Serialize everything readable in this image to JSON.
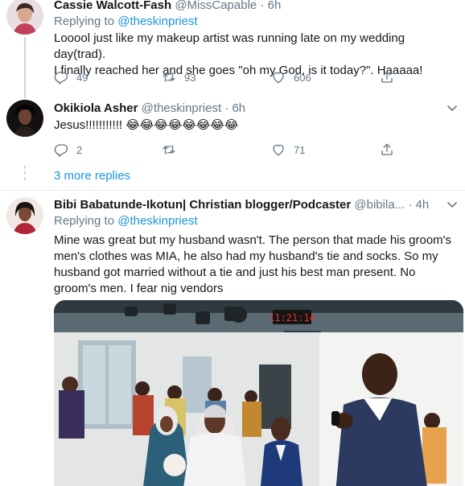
{
  "tweets": [
    {
      "name": "Cassie Walcott-Fash",
      "handle": "@MissCapable",
      "sep": "·",
      "time": "6h",
      "replying_prefix": "Replying to",
      "replying_to": "@theskinpriest",
      "text_lines": [
        "Looool just like my makeup artist was running late on my wedding day(trad).",
        "I finally reached her and she goes \"oh my God, is it today?\". Haaaaa!"
      ],
      "reply_count": "49",
      "retweet_count": "93",
      "like_count": "606"
    },
    {
      "name": "Okikiola Asher",
      "handle": "@theskinpriest",
      "sep": "·",
      "time": "6h",
      "text": "Jesus!!!!!!!!!!! 😂😂😂😂😂😂😂😂",
      "reply_count": "2",
      "retweet_count": "",
      "like_count": "71"
    },
    {
      "name": "Bibi Babatunde-Ikotun| Christian blogger/Podcaster",
      "handle": "@bibila...",
      "sep": "·",
      "time": "4h",
      "replying_prefix": "Replying to",
      "replying_to": "@theskinpriest",
      "text_lines": [
        "Mine was great but my husband wasn't. The person that made his groom's",
        "men's clothes was MIA, he also had my husband's tie and socks. So my",
        "husband got married without a tie and just his best man present. No",
        "groom's men. I fear nig vendors"
      ],
      "photo_clock": "11:21:14"
    }
  ],
  "more_replies": "3 more replies",
  "icons": {
    "reply": "reply-icon",
    "retweet": "retweet-icon",
    "like": "heart-icon",
    "share": "share-icon",
    "menu": "chevron-down-icon"
  },
  "colors": {
    "link": "#1b95e0",
    "secondary": "#657786",
    "divider": "#e6ecf0",
    "thread_line": "#ccd6dd"
  }
}
